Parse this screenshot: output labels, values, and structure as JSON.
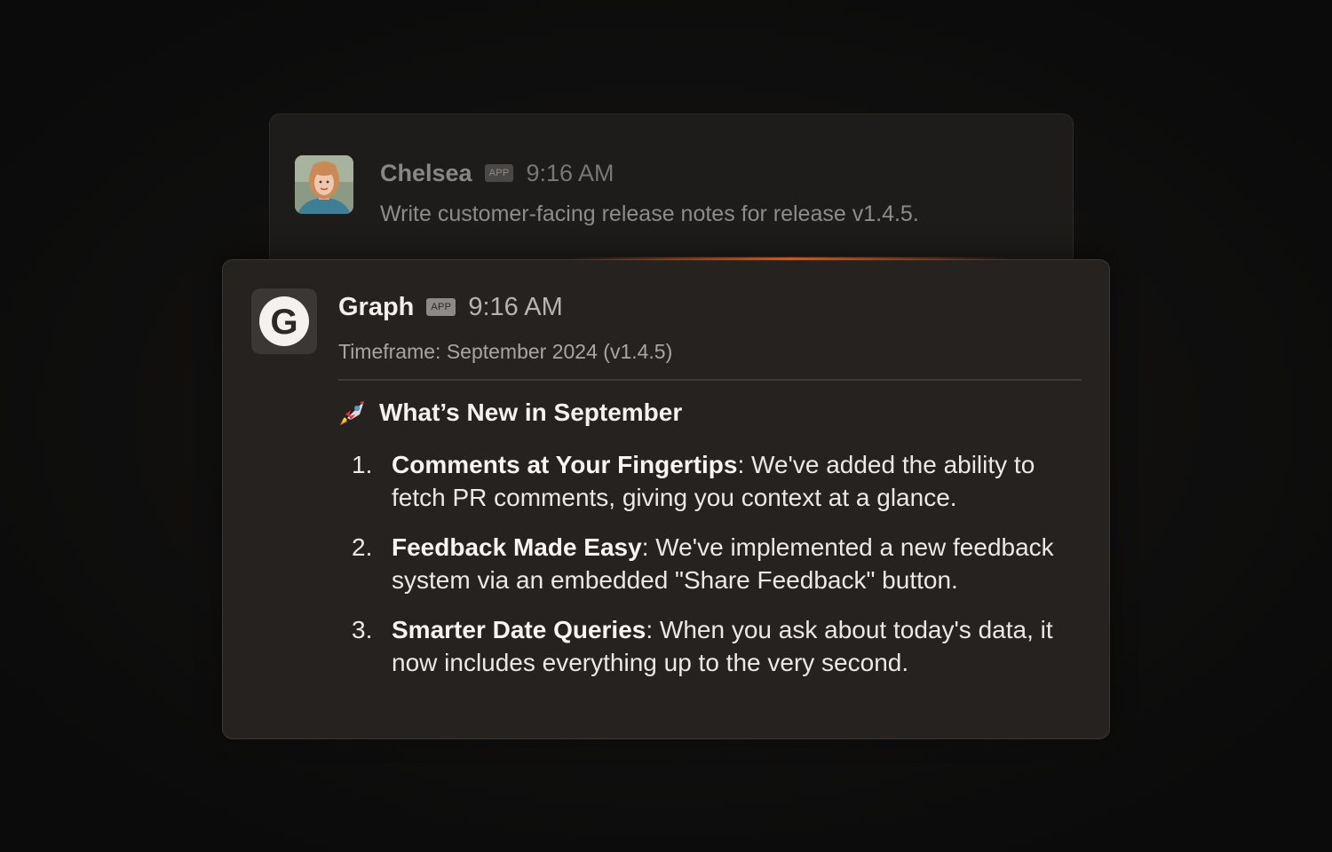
{
  "back_message": {
    "author": "Chelsea",
    "badge": "APP",
    "time": "9:16 AM",
    "text": "Write customer-facing release notes for release v1.4.5."
  },
  "front_message": {
    "author": "Graph",
    "badge": "APP",
    "time": "9:16 AM",
    "avatar_letter": "G",
    "timeframe": "Timeframe: September 2024 (v1.4.5)",
    "heading_icon": "rocket-icon",
    "heading": "What’s New in September",
    "items": [
      {
        "number": "1.",
        "title": "Comments at Your Fingertips",
        "text": ": We've added the ability to fetch PR comments, giving you context at a glance."
      },
      {
        "number": "2.",
        "title": "Feedback Made Easy",
        "text": ": We've implemented a new feedback system via an embedded \"Share Feedback\" button."
      },
      {
        "number": "3.",
        "title": "Smarter Date Queries",
        "text": ": When you ask about today's data, it now includes everything up to the very second."
      }
    ]
  },
  "colors": {
    "background": "#0b0b0b",
    "card_front": "#252220",
    "card_back": "#1e1c1b",
    "accent_glow": "#ff6e28"
  }
}
